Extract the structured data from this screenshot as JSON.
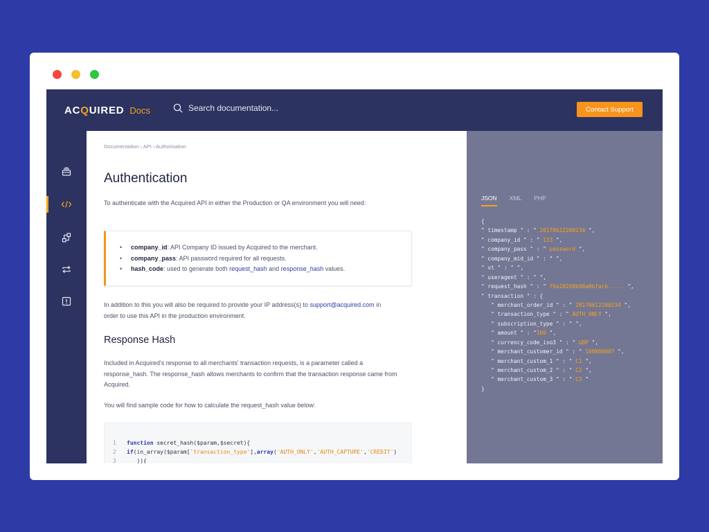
{
  "colors": {
    "background": "#2e3aa6",
    "accent": "#f7941d",
    "navbar": "#2c3360",
    "code_panel": "#747793"
  },
  "window": {
    "dots": [
      "#f5453d",
      "#f7be2f",
      "#2cc840"
    ]
  },
  "header": {
    "logo_prefix": "AC",
    "logo_q": "Q",
    "logo_suffix": "UIRED",
    "logo_docs": "Docs",
    "search_placeholder": "Search documentation...",
    "contact_label": "Contact Support"
  },
  "sidebar": {
    "items": [
      {
        "icon": "stack-icon",
        "active": false
      },
      {
        "icon": "code-icon",
        "active": true
      },
      {
        "icon": "flow-icon",
        "active": false
      },
      {
        "icon": "repeat-icon",
        "active": false
      },
      {
        "icon": "alert-icon",
        "active": false
      }
    ]
  },
  "content": {
    "breadcrumb": "Documentation › API › Authorisation",
    "title": "Authentication",
    "intro": "To authenticate with the Acquired API in either the Production or QA environment you will need:",
    "bullets": [
      {
        "key": "company_id",
        "text": ": API Company ID issued by Acquired to the merchant."
      },
      {
        "key": "company_pass",
        "text": ": API password required for all requests."
      },
      {
        "key": "hash_code",
        "text": ": used to generate both ",
        "link1": "request_hash",
        "mid": " and ",
        "link2": "response_hash",
        "end": " values."
      }
    ],
    "ip_para_pre": "In addition to this you will also be required to provide your IP address(s) to ",
    "ip_email": "support@acquired.com",
    "ip_para_post": " in",
    "ip_para_line2": "order to use this API in the production environment.",
    "hash_title": "Response Hash",
    "hash_para_1": "Included in Acquired's response to all merchants' transaction requests, is a parameter called a",
    "hash_para_2": "response_hash. The response_hash allows merchants to confirm that the transaction response came from",
    "hash_para_3": "Acquired.",
    "sample_para": "You will find sample code for how to calculate the request_hash value below:",
    "code": {
      "line1_num": "1",
      "line1_kw": "function",
      "line1_rest": " secret_hash($param,$secret){",
      "line2_num": "2",
      "line2_kw": "if",
      "line2_a": "(in_array($param[",
      "line2_s1": "'transaction_type'",
      "line2_b": "],",
      "line2_kw2": "array",
      "line2_c": "(",
      "line2_s2": "'AUTH_ONLY'",
      "line2_d": ",",
      "line2_s3": "'AUTH_CAPTURE'",
      "line2_e": ",",
      "line2_s4": "'CREDIT'",
      "line2_f": ")",
      "line3_num": "3",
      "line3_rest": "   )){"
    }
  },
  "code_panel": {
    "tabs": [
      "JSON",
      "XML",
      "PHP"
    ],
    "active_tab": 0,
    "json_lines": [
      {
        "k": "{",
        "v": "",
        "e": ""
      },
      {
        "k": "\" timestamp \" : \" ",
        "v": "20170612200234",
        "e": " \","
      },
      {
        "k": "\" company_id \" : \" ",
        "v": "133",
        "e": " \","
      },
      {
        "k": "\" company_pass \" : \" ",
        "v": "password",
        "e": " \","
      },
      {
        "k": "\" company_mid_id \" : \" \",",
        "v": "",
        "e": ""
      },
      {
        "k": "\" vt \" : \" \",",
        "v": "",
        "e": ""
      },
      {
        "k": "\" useragent \" : \" \",",
        "v": "",
        "e": ""
      },
      {
        "k": "\" request_hash \" : \" ",
        "v": "f0a18260b08a0bfacb.....",
        "e": " \","
      },
      {
        "k": "\" transaction \" : {",
        "v": "",
        "e": ""
      },
      {
        "k": "   \" merchant_order_id \" : \" ",
        "v": "20170612200234",
        "e": " \","
      },
      {
        "k": "   \" transaction_type \" : \" ",
        "v": "AUTH_ONLY",
        "e": " \","
      },
      {
        "k": "   \" subscription_type \" : \" \",",
        "v": "",
        "e": ""
      },
      {
        "k": "   \" amount \" : \"",
        "v": "100",
        "e": " \","
      },
      {
        "k": "   \" currency_code_iso3 \" : \" ",
        "v": "GBP",
        "e": " \","
      },
      {
        "k": "   \" merchant_customer_id \" : \" ",
        "v": "100000007",
        "e": " \","
      },
      {
        "k": "   \" merchant_custom_1 \" : \" ",
        "v": "C1",
        "e": " \","
      },
      {
        "k": "   \" merchant_custom_2 \" : \" ",
        "v": "C2",
        "e": " \","
      },
      {
        "k": "   \" merchant_custom_3 \" : \" ",
        "v": "C3",
        "e": " \""
      },
      {
        "k": "}",
        "v": "",
        "e": ""
      }
    ]
  }
}
